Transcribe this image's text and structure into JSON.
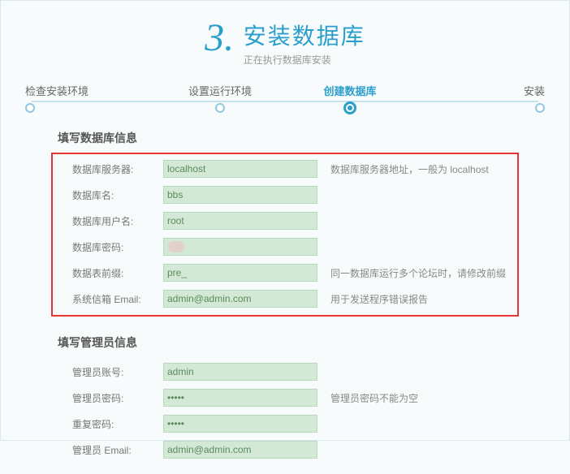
{
  "header": {
    "step_number": "3",
    "title": "安装数据库",
    "subtitle": "正在执行数据库安装"
  },
  "progress": {
    "steps": [
      "检查安装环境",
      "设置运行环境",
      "创建数据库",
      "安装"
    ],
    "active_index": 2
  },
  "section_db": {
    "title": "填写数据库信息",
    "rows": [
      {
        "label": "数据库服务器:",
        "value": "localhost",
        "hint": "数据库服务器地址，一般为 localhost"
      },
      {
        "label": "数据库名:",
        "value": "bbs",
        "hint": ""
      },
      {
        "label": "数据库用户名:",
        "value": "root",
        "hint": ""
      },
      {
        "label": "数据库密码:",
        "value": "",
        "hint": "",
        "pwdot": true
      },
      {
        "label": "数据表前缀:",
        "value": "pre_",
        "hint": "同一数据库运行多个论坛时，请修改前缀"
      },
      {
        "label": "系统信箱 Email:",
        "value": "admin@admin.com",
        "hint": "用于发送程序错误报告"
      }
    ]
  },
  "section_admin": {
    "title": "填写管理员信息",
    "rows": [
      {
        "label": "管理员账号:",
        "value": "admin",
        "hint": ""
      },
      {
        "label": "管理员密码:",
        "value": "•••••",
        "hint": "管理员密码不能为空"
      },
      {
        "label": "重复密码:",
        "value": "•••••",
        "hint": ""
      },
      {
        "label": "管理员 Email:",
        "value": "admin@admin.com",
        "hint": ""
      }
    ]
  }
}
